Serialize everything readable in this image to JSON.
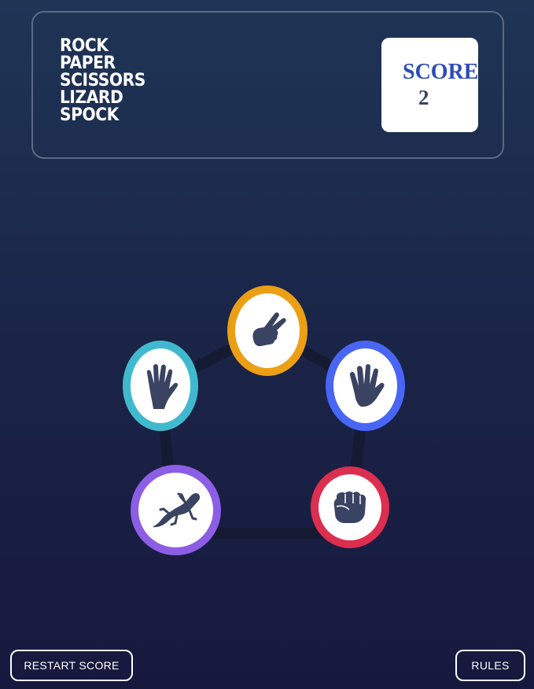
{
  "header": {
    "title_lines": [
      "ROCK",
      "PAPER",
      "SCISSORS",
      "LIZARD",
      "SPOCK"
    ],
    "score_label": "SCORE",
    "score_value": "2"
  },
  "tokens": [
    {
      "name": "scissors",
      "icon": "scissors-hand-icon",
      "ring_color": "#eb9f14"
    },
    {
      "name": "spock",
      "icon": "spock-hand-icon",
      "ring_color": "#40b9ce"
    },
    {
      "name": "paper",
      "icon": "open-hand-icon",
      "ring_color": "#4865f4"
    },
    {
      "name": "lizard",
      "icon": "lizard-icon",
      "ring_color": "#8c5de5"
    },
    {
      "name": "rock",
      "icon": "fist-icon",
      "ring_color": "#dc2e4e"
    }
  ],
  "footer": {
    "restart_label": "RESTART SCORE",
    "rules_label": "RULES"
  },
  "colors": {
    "icon": "#3b4363",
    "pentagon_line": "#151a33"
  }
}
